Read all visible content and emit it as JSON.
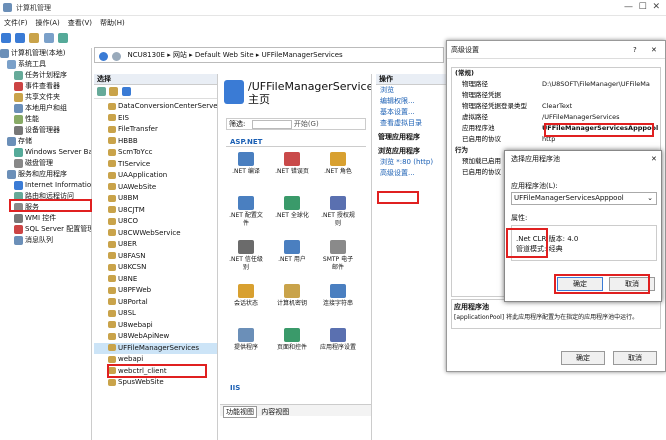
{
  "app_title": "计算机管理",
  "menu": [
    "文件(F)",
    "操作(A)",
    "查看(V)",
    "帮助(H)"
  ],
  "tree": {
    "root": "计算机管理(本地)",
    "items": [
      {
        "label": "系统工具",
        "indent": 1
      },
      {
        "label": "任务计划程序",
        "indent": 2
      },
      {
        "label": "事件查看器",
        "indent": 2
      },
      {
        "label": "共享文件夹",
        "indent": 2
      },
      {
        "label": "本地用户和组",
        "indent": 2
      },
      {
        "label": "性能",
        "indent": 2
      },
      {
        "label": "设备管理器",
        "indent": 2
      },
      {
        "label": "存储",
        "indent": 1
      },
      {
        "label": "Windows Server Back",
        "indent": 2
      },
      {
        "label": "磁盘管理",
        "indent": 2
      },
      {
        "label": "服务和应用程序",
        "indent": 1
      },
      {
        "label": "Internet Information S",
        "indent": 2
      },
      {
        "label": "路由和远程访问",
        "indent": 2
      },
      {
        "label": "服务",
        "indent": 2
      },
      {
        "label": "WMI 控件",
        "indent": 2
      },
      {
        "label": "SQL Server 配置管理器",
        "indent": 2
      },
      {
        "label": "消息队列",
        "indent": 2
      }
    ]
  },
  "breadcrumb": [
    "NCU8130E",
    "网站",
    "Default Web Site",
    "UFFileManagerServices"
  ],
  "sites_header": "选择",
  "sites": [
    "DataConversionCenterServer",
    "EIS",
    "FileTransfer",
    "HBBB",
    "ScmToYcc",
    "TIService",
    "UAApplication",
    "UAWebSite",
    "U8BM",
    "U8CJTM",
    "U8CO",
    "U8CWWebService",
    "U8ER",
    "U8FASN",
    "U8KCSN",
    "U8NE",
    "U8PFWeb",
    "U8Portal",
    "U8SL",
    "U8webapi",
    "U8WebApiNew",
    "UFFileManagerServices",
    "webapi",
    "webctrl_client",
    "SpusWebSite"
  ],
  "center": {
    "title": "/UFFileManagerServices 主页",
    "filter_label": "筛选:",
    "go_label": "开始(G)",
    "section": "ASP.NET",
    "features": [
      ".NET 编译",
      ".NET 错误页",
      ".NET 角色",
      ".NET 配置文件",
      ".NET 全球化",
      ".NET 授权规则",
      ".NET 信任级别",
      ".NET 用户",
      "SMTP 电子邮件",
      "会话状态",
      "计算机密钥",
      "连接字符串",
      "提供程序",
      "页面和控件",
      "应用程序设置"
    ],
    "section2": "IIS",
    "tab_features": "功能视图",
    "tab_content": "内容视图"
  },
  "actions": {
    "header": "操作",
    "links1": [
      "浏览",
      "编辑权限...",
      "基本设置...",
      "查看虚拟目录"
    ],
    "manage_header": "管理应用程序",
    "browse_header": "浏览应用程序",
    "browse_link": "浏览 *:80 (http)",
    "advanced_link": "高级设置..."
  },
  "adv_dialog": {
    "title": "高级设置",
    "help": "?",
    "close": "✕",
    "group1": "(常规)",
    "props": [
      {
        "k": "物理路径",
        "v": "D:\\U8SOFT\\FileManager\\UFFileMa"
      },
      {
        "k": "物理路径凭据",
        "v": ""
      },
      {
        "k": "物理路径凭据登录类型",
        "v": "ClearText"
      },
      {
        "k": "虚拟路径",
        "v": "/UFFileManagerServices"
      },
      {
        "k": "应用程序池",
        "v": "UFFileManagerServicesApppool"
      },
      {
        "k": "已启用的协议",
        "v": "http"
      }
    ],
    "group2": "行为",
    "props2": [
      {
        "k": "预加载已启用",
        "v": "False"
      },
      {
        "k": "已启用的协议",
        "v": ""
      }
    ],
    "desc_title": "应用程序池",
    "desc": "[applicationPool] 将此应用程序配置为在指定的应用程序池中运行。",
    "ok": "确定",
    "cancel": "取消"
  },
  "pool_dialog": {
    "title": "选择应用程序池",
    "close": "✕",
    "label": "应用程序池(L):",
    "selected": "UFFileManagerServicesApppool",
    "props_label": "属性:",
    "clr": ".Net CLR 版本: 4.0",
    "pipeline": "管道模式: 经典",
    "ok": "确定",
    "cancel": "取消"
  },
  "colors": {
    "highlight": "#e02020",
    "selection": "#cce4f7",
    "link": "#1a5fb4"
  }
}
